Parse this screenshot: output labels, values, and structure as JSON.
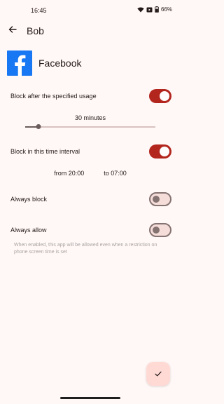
{
  "status_bar": {
    "time": "16:45",
    "battery": "66%"
  },
  "app_bar": {
    "title": "Bob"
  },
  "app": {
    "name": "Facebook"
  },
  "settings": {
    "block_after_usage": {
      "label": "Block after the specified usage",
      "enabled": true
    },
    "usage_limit": {
      "value_label": "30 minutes",
      "fraction": 0.1
    },
    "block_interval": {
      "label": "Block in this time interval",
      "enabled": true,
      "from": "from 20:00",
      "to": "to 07:00"
    },
    "always_block": {
      "label": "Always block",
      "enabled": false
    },
    "always_allow": {
      "label": "Always allow",
      "enabled": false,
      "helper": "When enabled, this app will be allowed even when a restriction on phone screen time is set"
    }
  },
  "colors": {
    "accent": "#B3261E",
    "background": "#FFF8F7",
    "facebook": "#1877F2"
  },
  "icons": {
    "back": "arrow-left-icon",
    "confirm": "check-icon"
  }
}
